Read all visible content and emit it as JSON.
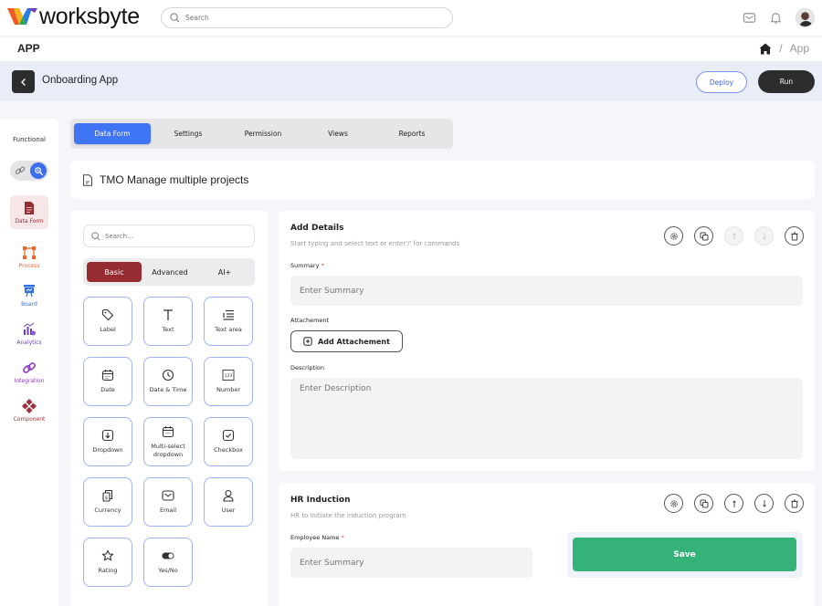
{
  "brand": {
    "name": "worksbyte"
  },
  "topbar": {
    "search_placeholder": "Search"
  },
  "app_header": {
    "section_title": "APP",
    "breadcrumb": [
      "App"
    ]
  },
  "toolbar": {
    "app_name": "Onboarding App",
    "deploy_label": "Deploy",
    "run_label": "Run"
  },
  "rail": {
    "mode_label": "Functional",
    "items": [
      {
        "label": "Data Form",
        "icon": "document-icon",
        "color": "#962b32",
        "active": true
      },
      {
        "label": "Process",
        "icon": "process-icon",
        "color": "#f0662a"
      },
      {
        "label": "Board",
        "icon": "board-icon",
        "color": "#2f6fe6"
      },
      {
        "label": "Analytics",
        "icon": "analytics-icon",
        "color": "#6b3fb8"
      },
      {
        "label": "Integration",
        "icon": "integration-icon",
        "color": "#8a35c9"
      },
      {
        "label": "Component",
        "icon": "component-icon",
        "color": "#a0303b"
      }
    ]
  },
  "tabs": [
    {
      "label": "Data Form",
      "active": true
    },
    {
      "label": "Settings"
    },
    {
      "label": "Permission"
    },
    {
      "label": "Views"
    },
    {
      "label": "Reports"
    }
  ],
  "form_title": "TMO Manage multiple projects",
  "palette": {
    "search_placeholder": "Search...",
    "segments": [
      {
        "label": "Basic",
        "active": true
      },
      {
        "label": "Advanced"
      },
      {
        "label": "AI+"
      }
    ],
    "fields": [
      {
        "label": "Label",
        "icon": "tag-icon"
      },
      {
        "label": "Text",
        "icon": "text-icon"
      },
      {
        "label": "Text area",
        "icon": "text-area-icon"
      },
      {
        "label": "Date",
        "icon": "calendar-icon"
      },
      {
        "label": "Date & Time",
        "icon": "clock-icon"
      },
      {
        "label": "Number",
        "icon": "number-icon"
      },
      {
        "label": "Dropdown",
        "icon": "dropdown-icon"
      },
      {
        "label": "Multi-select dropdown",
        "icon": "calendar-icon"
      },
      {
        "label": "Checkbox",
        "icon": "checkbox-icon"
      },
      {
        "label": "Currency",
        "icon": "currency-icon"
      },
      {
        "label": "Email",
        "icon": "email-icon"
      },
      {
        "label": "User",
        "icon": "user-icon"
      },
      {
        "label": "Rating",
        "icon": "star-icon"
      },
      {
        "label": "Yes/No",
        "icon": "toggle-icon"
      }
    ]
  },
  "sections": [
    {
      "title": "Add Details",
      "subtitle": "Start typing and select text or enter'/' for commands",
      "summary_label": "Summary",
      "summary_placeholder": "Enter Summary",
      "attachment_label": "Attachement",
      "attachment_button": "Add Attachement",
      "description_label": "Description",
      "description_placeholder": "Enter Description",
      "move_up_enabled": false,
      "move_down_enabled": false
    },
    {
      "title": "HR Induction",
      "subtitle": "HR to initiate the induction program",
      "employee_label": "Employee Name",
      "employee_placeholder": "Enter Summary",
      "save_label": "Save",
      "move_up_enabled": true,
      "move_down_enabled": true
    }
  ],
  "required_marker": "*",
  "colors": {
    "primary_blue": "#3f74f5",
    "basic_red": "#962b32",
    "save_green": "#34b277",
    "dark": "#2d2d2d"
  }
}
